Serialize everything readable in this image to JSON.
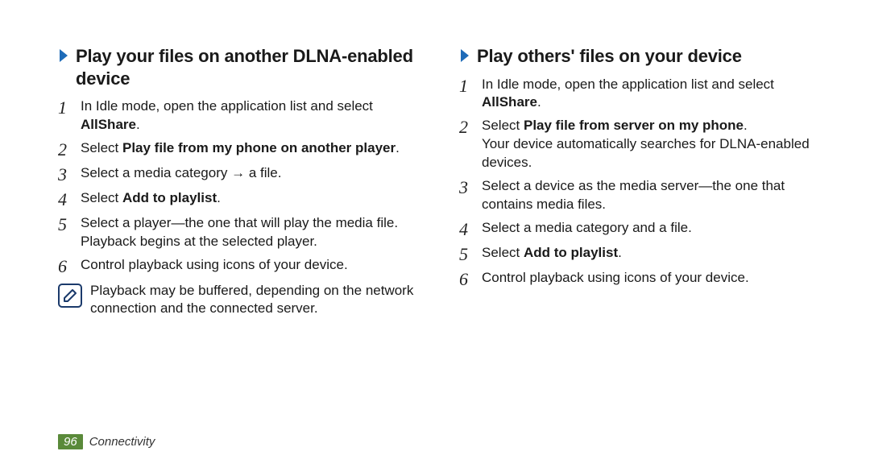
{
  "left": {
    "heading": "Play your files on another DLNA-enabled device",
    "steps": [
      {
        "n": "1",
        "pre": "In Idle mode, open the application list and select ",
        "bold": "AllShare",
        "post": "."
      },
      {
        "n": "2",
        "pre": "Select ",
        "bold": "Play file from my phone on another player",
        "post": "."
      },
      {
        "n": "3",
        "pre": "Select a media category → a file.",
        "bold": "",
        "post": ""
      },
      {
        "n": "4",
        "pre": "Select ",
        "bold": "Add to playlist",
        "post": "."
      },
      {
        "n": "5",
        "pre": "Select a player—the one that will play the media file. Playback begins at the selected player.",
        "bold": "",
        "post": ""
      },
      {
        "n": "6",
        "pre": "Control playback using icons of your device.",
        "bold": "",
        "post": ""
      }
    ],
    "note": "Playback may be buffered, depending on the network connection and the connected server."
  },
  "right": {
    "heading": "Play others' files on your device",
    "steps": [
      {
        "n": "1",
        "pre": "In Idle mode, open the application list and select ",
        "bold": "AllShare",
        "post": "."
      },
      {
        "n": "2",
        "pre": "Select ",
        "bold": "Play file from server on my phone",
        "post": ".",
        "extra": "Your device automatically searches for DLNA-enabled devices."
      },
      {
        "n": "3",
        "pre": "Select a device as the media server—the one that contains media files.",
        "bold": "",
        "post": ""
      },
      {
        "n": "4",
        "pre": "Select a media category and a file.",
        "bold": "",
        "post": ""
      },
      {
        "n": "5",
        "pre": "Select ",
        "bold": "Add to playlist",
        "post": "."
      },
      {
        "n": "6",
        "pre": "Control playback using icons of your device.",
        "bold": "",
        "post": ""
      }
    ]
  },
  "footer": {
    "page": "96",
    "section": "Connectivity"
  },
  "colors": {
    "chevron": "#1e6bb8",
    "note_border": "#1b3a6b",
    "page_bg": "#5a8a3a"
  }
}
